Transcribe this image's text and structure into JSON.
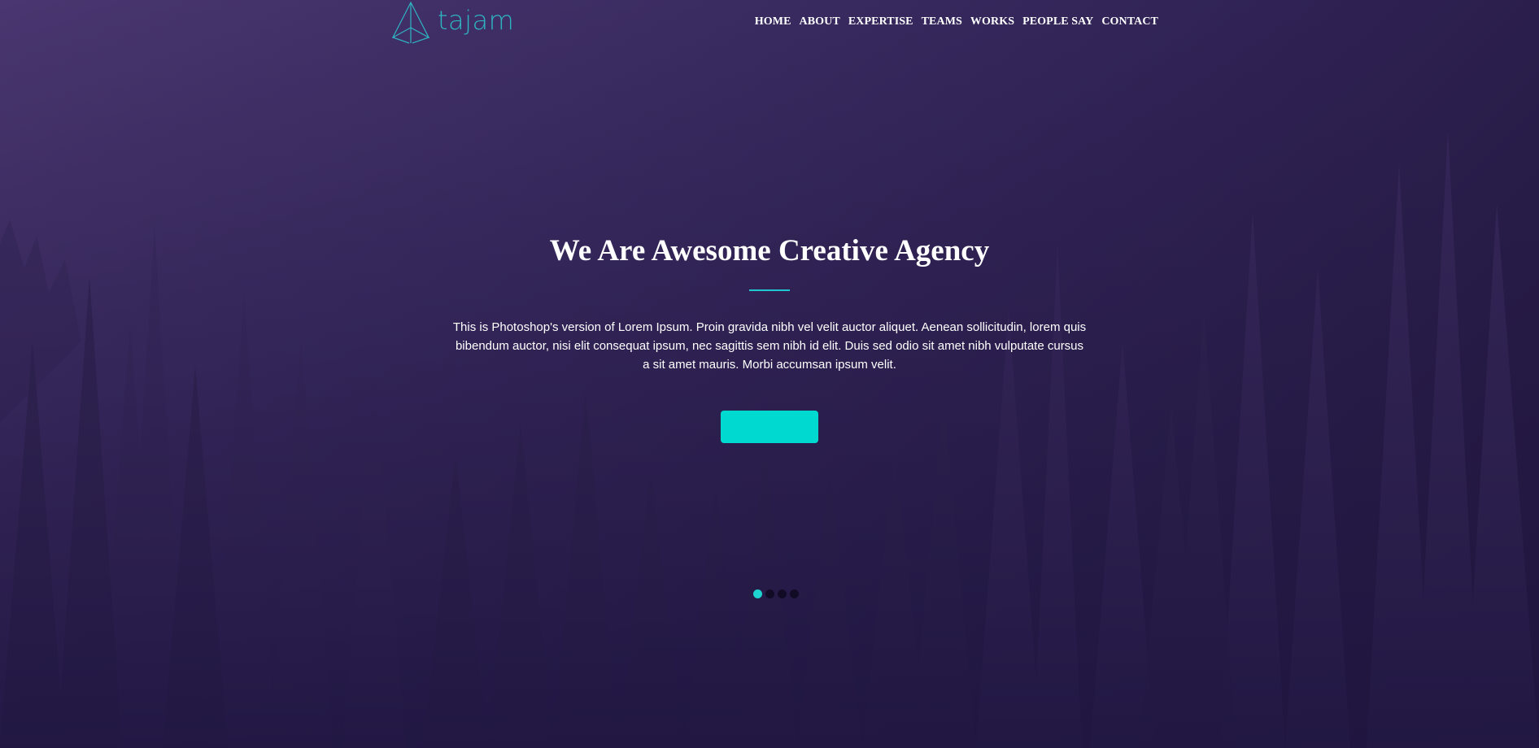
{
  "brand": {
    "name": "tajam",
    "accent_color": "#1fc7d0",
    "logo_icon": "paper-plane-icon"
  },
  "nav": {
    "items": [
      {
        "label": "HOME"
      },
      {
        "label": "ABOUT"
      },
      {
        "label": "EXPERTISE"
      },
      {
        "label": "TEAMS"
      },
      {
        "label": "WORKS"
      },
      {
        "label": "PEOPLE SAY"
      },
      {
        "label": "CONTACT"
      }
    ]
  },
  "hero": {
    "title": "We Are Awesome Creative Agency",
    "description": "This is Photoshop's version of Lorem Ipsum. Proin gravida nibh vel velit auctor aliquet. Aenean sollicitudin, lorem quis bibendum auctor, nisi elit consequat ipsum, nec sagittis sem nibh id elit. Duis sed odio sit amet nibh vulputate cursus a sit amet mauris. Morbi accumsan ipsum velit.",
    "button_label": "",
    "button_color": "#00d9cf",
    "background_colors": [
      "#4a3670",
      "#2e2152",
      "#1c1336"
    ]
  },
  "slider": {
    "count": 4,
    "active_index": 0
  }
}
